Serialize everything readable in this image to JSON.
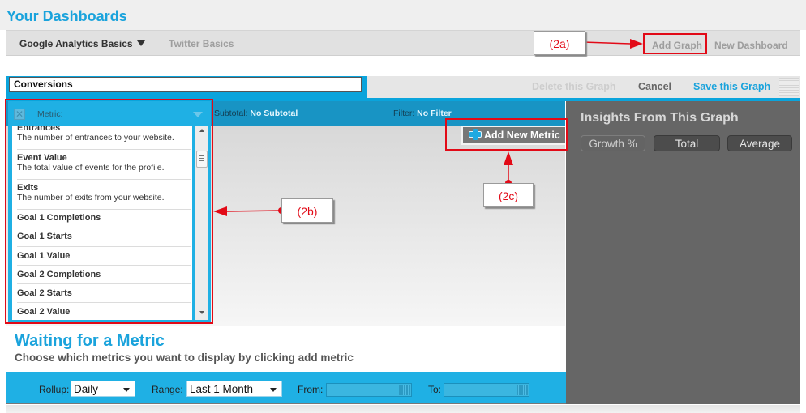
{
  "header": {
    "title": "Your Dashboards"
  },
  "tabs": [
    {
      "label": "Google Analytics Basics",
      "active": true,
      "has_dropdown": true
    },
    {
      "label": "Twitter Basics",
      "active": false
    }
  ],
  "tab_actions": {
    "add_graph": "Add Graph",
    "new_dashboard": "New Dashboard"
  },
  "editor": {
    "graph_title_value": "Conversions",
    "delete_label": "Delete this Graph",
    "cancel_label": "Cancel",
    "save_label": "Save this Graph"
  },
  "metric_bar": {
    "metric_label": "Metric:",
    "subtotal_label": "Subtotal:",
    "subtotal_value": "No Subtotal",
    "filter_label": "Filter:",
    "filter_value": "No Filter"
  },
  "metric_list": [
    {
      "name": "Entrances",
      "description": "The number of entrances to your website."
    },
    {
      "name": "Event Value",
      "description": "The total value of events for the profile."
    },
    {
      "name": "Exits",
      "description": "The number of exits from your website."
    },
    {
      "name": "Goal 1 Completions",
      "description": ""
    },
    {
      "name": "Goal 1 Starts",
      "description": ""
    },
    {
      "name": "Goal 1 Value",
      "description": ""
    },
    {
      "name": "Goal 2 Completions",
      "description": ""
    },
    {
      "name": "Goal 2 Starts",
      "description": ""
    },
    {
      "name": "Goal 2 Value",
      "description": ""
    }
  ],
  "graph": {
    "add_metric_label": "Add New Metric",
    "waiting_title": "Waiting for a Metric",
    "waiting_subtitle": "Choose which metrics you want to display by clicking add metric"
  },
  "controls": {
    "rollup_label": "Rollup:",
    "rollup_value": "Daily",
    "range_label": "Range:",
    "range_value": "Last 1 Month",
    "from_label": "From:",
    "from_value": "",
    "to_label": "To:",
    "to_value": ""
  },
  "insights": {
    "title": "Insights From This Graph",
    "buttons": [
      "Growth %",
      "Total",
      "Average"
    ]
  },
  "annotations": {
    "a": "(2a)",
    "b": "(2b)",
    "c": "(2c)",
    "color": "#e20a17"
  },
  "colors": {
    "brand_blue": "#1aa3dc",
    "panel_grey": "#666666"
  }
}
